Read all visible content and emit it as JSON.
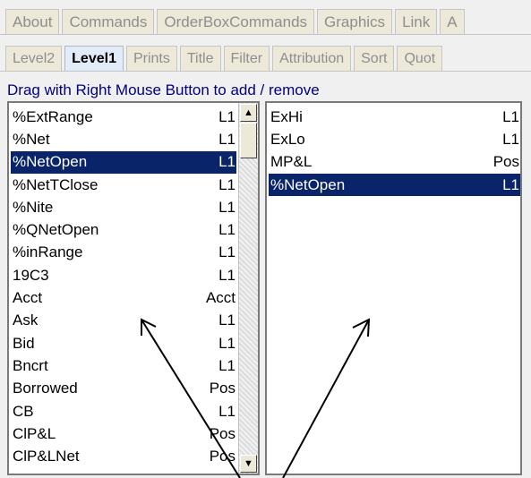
{
  "tabs_top": [
    "About",
    "Commands",
    "OrderBoxCommands",
    "Graphics",
    "Link",
    "A"
  ],
  "tabs_second": [
    {
      "label": "Level2",
      "active": false
    },
    {
      "label": "Level1",
      "active": true
    },
    {
      "label": "Prints",
      "active": false
    },
    {
      "label": "Title",
      "active": false
    },
    {
      "label": "Filter",
      "active": false
    },
    {
      "label": "Attribution",
      "active": false
    },
    {
      "label": "Sort",
      "active": false
    },
    {
      "label": "Quot",
      "active": false
    }
  ],
  "instruction": "Drag with Right Mouse Button to add / remove",
  "available_list": [
    {
      "name": "%ExtRange",
      "level": "L1",
      "selected": false
    },
    {
      "name": "%Net",
      "level": "L1",
      "selected": false
    },
    {
      "name": "%NetOpen",
      "level": "L1",
      "selected": true
    },
    {
      "name": "%NetTClose",
      "level": "L1",
      "selected": false
    },
    {
      "name": "%Nite",
      "level": "L1",
      "selected": false
    },
    {
      "name": "%QNetOpen",
      "level": "L1",
      "selected": false
    },
    {
      "name": "%inRange",
      "level": "L1",
      "selected": false
    },
    {
      "name": "19C3",
      "level": "L1",
      "selected": false
    },
    {
      "name": "Acct",
      "level": "Acct",
      "selected": false
    },
    {
      "name": "Ask",
      "level": "L1",
      "selected": false
    },
    {
      "name": "Bid",
      "level": "L1",
      "selected": false
    },
    {
      "name": "Bncrt",
      "level": "L1",
      "selected": false
    },
    {
      "name": "Borrowed",
      "level": "Pos",
      "selected": false
    },
    {
      "name": "CB",
      "level": "L1",
      "selected": false
    },
    {
      "name": "ClP&L",
      "level": "Pos",
      "selected": false
    },
    {
      "name": "ClP&LNet",
      "level": "Pos",
      "selected": false
    }
  ],
  "selected_list": [
    {
      "name": "ExHi",
      "level": "L1",
      "selected": false
    },
    {
      "name": "ExLo",
      "level": "L1",
      "selected": false
    },
    {
      "name": "MP&L",
      "level": "Pos",
      "selected": false
    },
    {
      "name": "%NetOpen",
      "level": "L1",
      "selected": true
    }
  ],
  "colors": {
    "selection": "#0a246a",
    "instruction_text": "#000080",
    "active_tab": "#e2ebf8"
  },
  "icons": {
    "scroll_up": "triangle-up-icon",
    "scroll_down": "triangle-down-icon"
  }
}
